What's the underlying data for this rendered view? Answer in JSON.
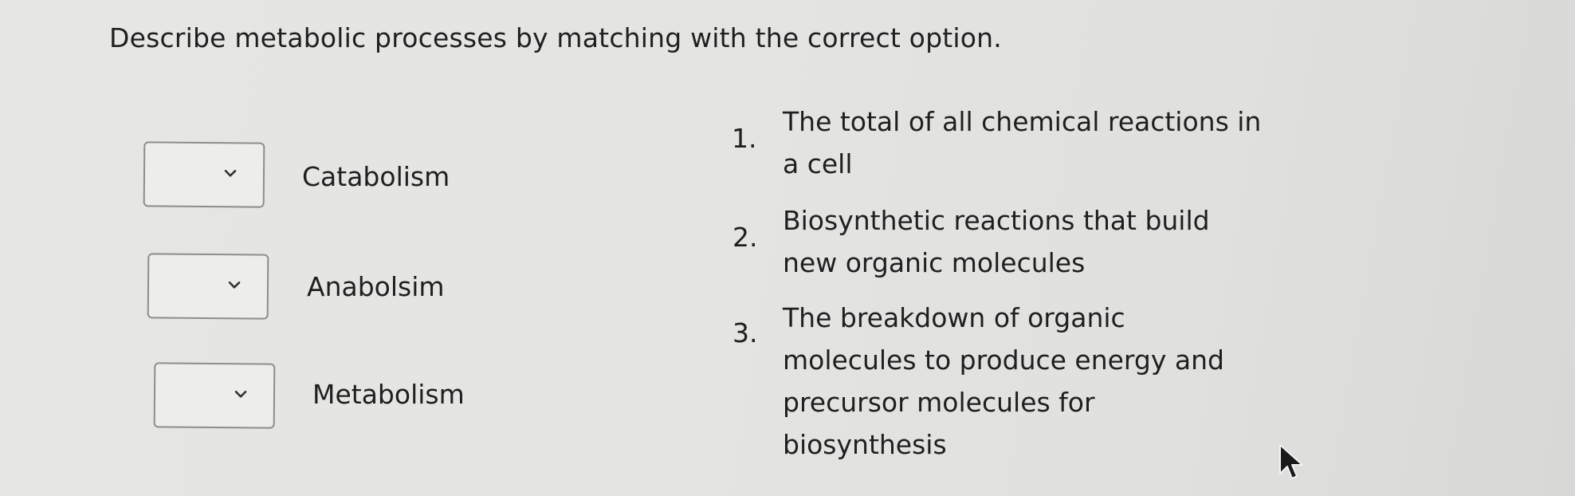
{
  "question": "Describe metabolic processes by matching with the correct option.",
  "matches": [
    {
      "term": "Catabolism",
      "selected": ""
    },
    {
      "term": "Anabolsim",
      "selected": ""
    },
    {
      "term": "Metabolism",
      "selected": ""
    }
  ],
  "options": [
    {
      "number": "1.",
      "lines": [
        "The total of all chemical reactions in",
        "a cell"
      ]
    },
    {
      "number": "2.",
      "lines": [
        "Biosynthetic reactions that build",
        "new organic molecules"
      ]
    },
    {
      "number": "3.",
      "lines": [
        "The breakdown of organic",
        "molecules to produce energy and",
        "precursor molecules for",
        "biosynthesis"
      ]
    }
  ]
}
